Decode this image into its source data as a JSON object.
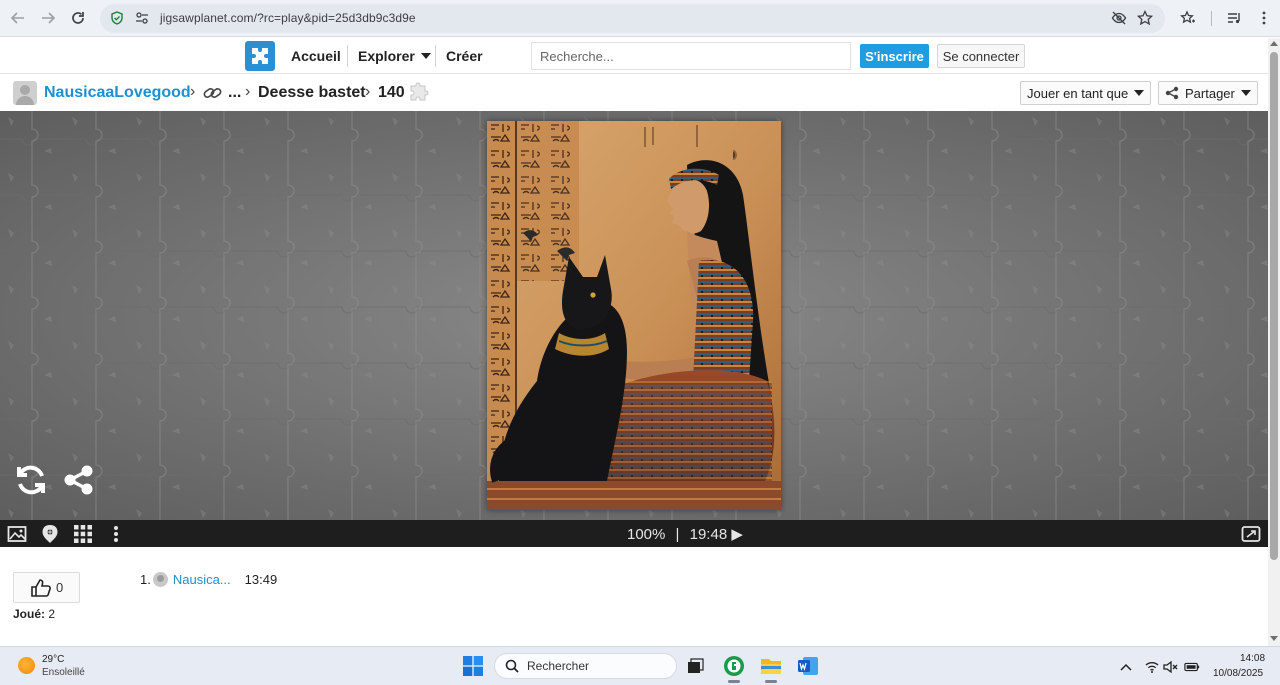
{
  "browser": {
    "url": "jigsawplanet.com/?rc=play&pid=25d3db9c3d9e"
  },
  "site": {
    "nav": {
      "home": "Accueil",
      "explore": "Explorer",
      "create": "Créer"
    },
    "search_placeholder": "Recherche...",
    "signup": "S'inscrire",
    "login": "Se connecter"
  },
  "puzzle": {
    "owner": "NausicaaLovegood",
    "ellipsis": "...",
    "title": "Deesse bastet",
    "piece_count": "140",
    "play_as": "Jouer en tant que",
    "share": "Partager"
  },
  "controls": {
    "progress": "100%",
    "separator": "|",
    "timer": "19:48 ▶"
  },
  "stats": {
    "likes": "0",
    "played_label": "Joué:",
    "played_count": "2"
  },
  "scores": [
    {
      "rank": "1.",
      "name": "Nausica...",
      "time": "13:49"
    }
  ],
  "taskbar": {
    "weather_temp": "29°C",
    "weather_desc": "Ensoleillé",
    "search": "Rechercher",
    "time": "14:08",
    "date": "10/08/2025"
  },
  "colors": {
    "brand_blue": "#1e9ee0",
    "link_blue": "#1e8fcf",
    "board_gray": "#7b7b7b",
    "control_bar": "#1e1e1e"
  },
  "icons": {
    "logo": "puzzle-piece-icon",
    "shuffle": "refresh-icon",
    "share": "share-icon",
    "image": "image-icon",
    "ghost": "ghost-image-icon",
    "pieces": "grid-icon",
    "menu": "more-vertical-icon",
    "fullscreen": "fullscreen-icon"
  }
}
